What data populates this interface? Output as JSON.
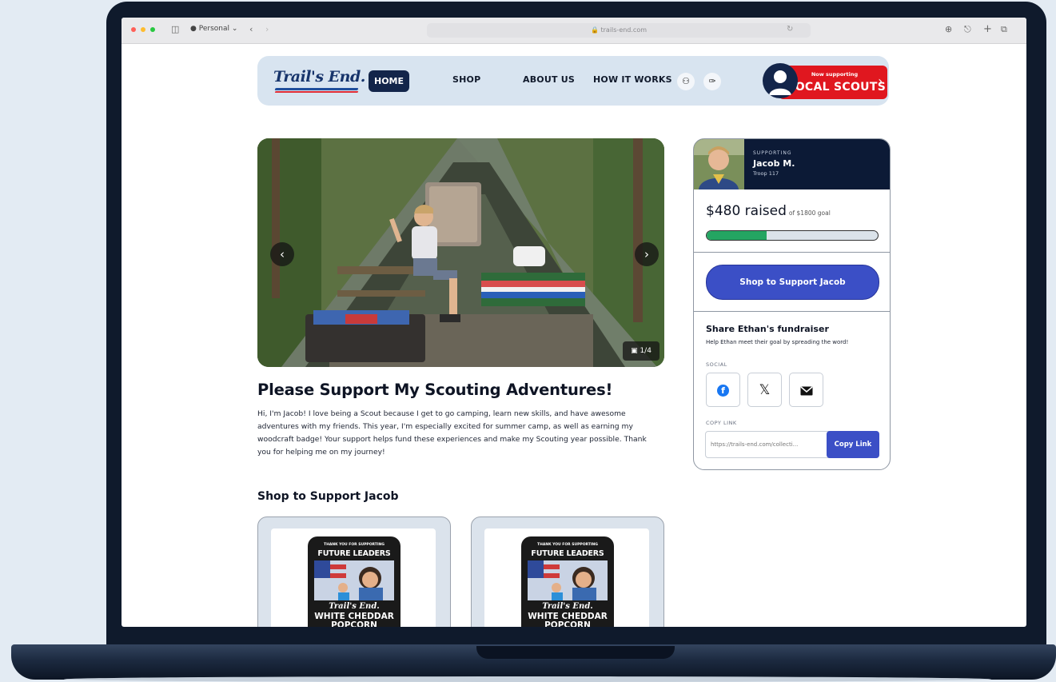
{
  "browser": {
    "profile_label": "Personal",
    "url": "trails-end.com"
  },
  "nav": {
    "logo_text": "Trail's End.",
    "items": [
      "HOME",
      "SHOP",
      "ABOUT US",
      "HOW IT WORKS"
    ],
    "cta_small": "Now supporting",
    "cta_big": "LOCAL SCOUTS"
  },
  "hero": {
    "counter": "1/4"
  },
  "page": {
    "title": "Please Support My Scouting Adventures!",
    "body": "Hi, I'm Jacob! I love being a Scout because I get to go camping, learn new skills, and have awesome adventures with my friends. This year, I'm especially excited for summer camp, as well as earning my woodcraft badge! Your support helps fund these experiences and make my Scouting year possible. Thank you for helping me on my journey!",
    "shop_title": "Shop to Support Jacob"
  },
  "products": [
    {
      "bag_top": "THANK YOU FOR SUPPORTING",
      "bag_headline": "FUTURE LEADERS",
      "brand": "Trail's End.",
      "name_line1": "WHITE CHEDDAR",
      "name_line2": "POPCORN"
    },
    {
      "bag_top": "THANK YOU FOR SUPPORTING",
      "bag_headline": "FUTURE LEADERS",
      "brand": "Trail's End.",
      "name_line1": "WHITE CHEDDAR",
      "name_line2": "POPCORN"
    }
  ],
  "sidebar": {
    "supporting_label": "SUPPORTING",
    "scout_name": "Jacob M.",
    "troop": "Troop 117",
    "raised": "$480 raised",
    "goal": "of $1800 goal",
    "progress": 0.35,
    "shop_button": "Shop to Support Jacob",
    "share_title": "Share Ethan's fundraiser",
    "share_sub": "Help Ethan meet their goal by spreading the word!",
    "social_label": "SOCIAL",
    "copy_label": "COPY LINK",
    "copy_value": "https://trails-end.com/collecti...",
    "copy_button": "Copy Link"
  },
  "colors": {
    "brand_navy": "#13254a",
    "cta_red": "#e0171f",
    "button_blue": "#3b4fc6",
    "progress_green": "#24a562"
  }
}
